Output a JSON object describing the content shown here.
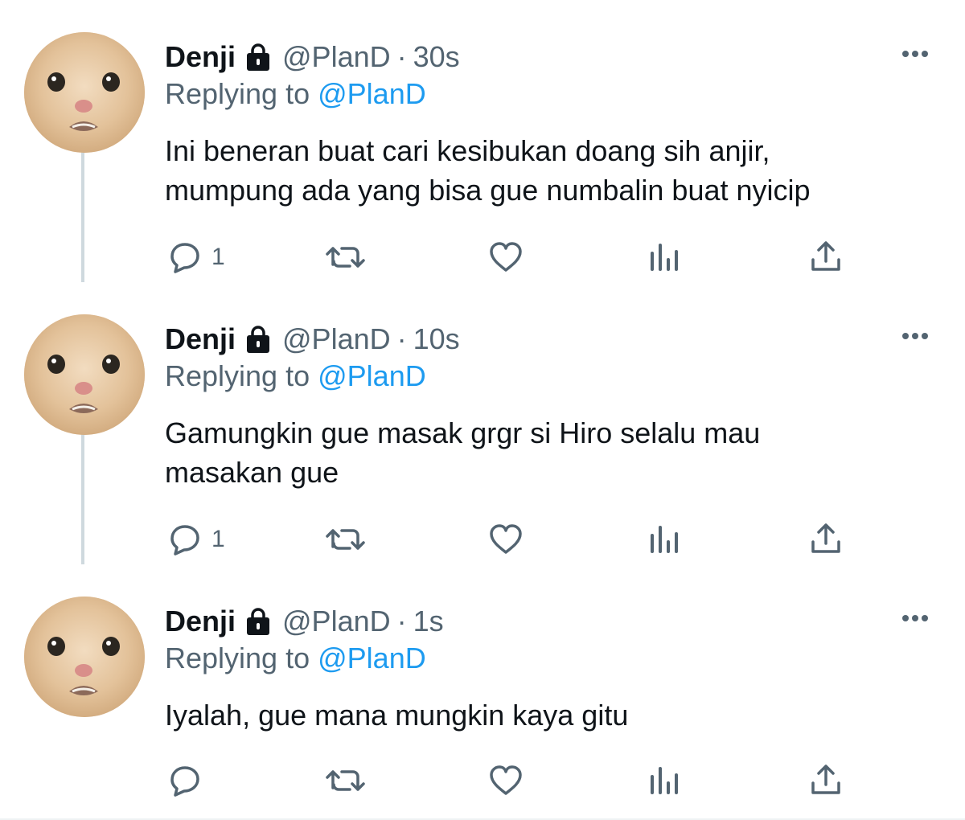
{
  "tweets": [
    {
      "name": "Denji",
      "handle": "@PlanD",
      "separator": "·",
      "time": "30s",
      "replying_prefix": "Replying to",
      "replying_to": "@PlanD",
      "lines": [
        "Ini beneran buat cari kesibukan doang sih anjir,",
        "mumpung ada yang bisa gue numbalin buat nyicip"
      ],
      "reply_count": "1"
    },
    {
      "name": "Denji",
      "handle": "@PlanD",
      "separator": "·",
      "time": "10s",
      "replying_prefix": "Replying to",
      "replying_to": "@PlanD",
      "lines": [
        "Gamungkin gue masak grgr si Hiro selalu mau",
        "masakan gue"
      ],
      "reply_count": "1"
    },
    {
      "name": "Denji",
      "handle": "@PlanD",
      "separator": "·",
      "time": "1s",
      "replying_prefix": "Replying to",
      "replying_to": "@PlanD",
      "lines": [
        "Iyalah, gue mana mungkin kaya gitu",
        ""
      ],
      "reply_count": ""
    }
  ],
  "icons": {
    "avatar": "cat-avatar",
    "lock": "lock-icon",
    "more": "more-icon",
    "reply": "reply-icon",
    "retweet": "retweet-icon",
    "like": "heart-icon",
    "analytics": "analytics-icon",
    "share": "share-icon"
  },
  "colors": {
    "text": "#0f1419",
    "secondary": "#536471",
    "link": "#1d9bf0",
    "thread_line": "#cfd9de",
    "icon": "#536471"
  }
}
